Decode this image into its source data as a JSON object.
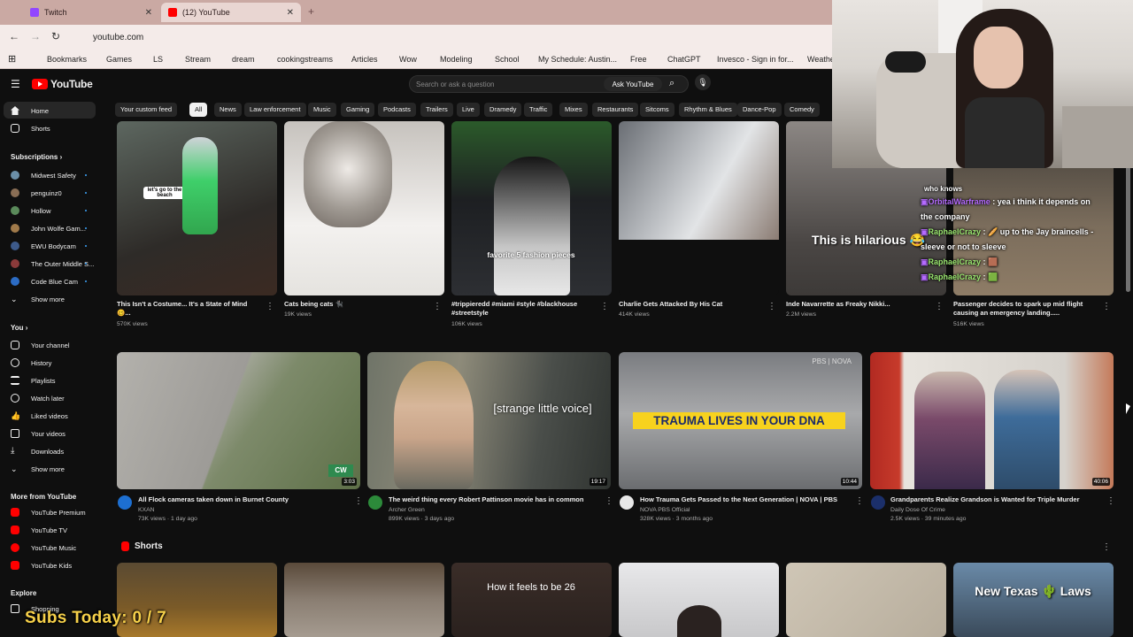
{
  "browser": {
    "tabs": [
      {
        "label": "Twitch"
      },
      {
        "label": "(12) YouTube"
      }
    ],
    "url": "youtube.com",
    "bookmarks": [
      "Bookmarks",
      "Games",
      "LS",
      "Stream",
      "dream",
      "cookingstreams",
      "Articles",
      "Wow",
      "Modeling",
      "School",
      "My Schedule: Austin...",
      "Free",
      "ChatGPT",
      "Invesco - Sign in for...",
      "Weathe"
    ]
  },
  "youtube": {
    "logo": "YouTube",
    "search_placeholder": "Search or ask a question",
    "ask_label": "Ask YouTube",
    "chips": [
      "Your custom feed",
      "All",
      "News",
      "Law enforcement",
      "Music",
      "Gaming",
      "Podcasts",
      "Trailers",
      "Live",
      "Dramedy",
      "Traffic",
      "Mixes",
      "Restaurants",
      "Sitcoms",
      "Rhythm & Blues",
      "Dance-Pop",
      "Comedy"
    ],
    "sidebar": {
      "main": [
        {
          "label": "Home"
        },
        {
          "label": "Shorts"
        }
      ],
      "subs_head": "Subscriptions",
      "subs": [
        {
          "label": "Midwest Safety"
        },
        {
          "label": "penguinz0"
        },
        {
          "label": "Hollow"
        },
        {
          "label": "John Wolfe Gam..."
        },
        {
          "label": "EWU Bodycam"
        },
        {
          "label": "The Outer Middle S..."
        },
        {
          "label": "Code Blue Cam"
        },
        {
          "label": "Show more"
        }
      ],
      "you_head": "You",
      "you": [
        {
          "label": "Your channel"
        },
        {
          "label": "History"
        },
        {
          "label": "Playlists"
        },
        {
          "label": "Watch later"
        },
        {
          "label": "Liked videos"
        },
        {
          "label": "Your videos"
        },
        {
          "label": "Downloads"
        },
        {
          "label": "Show more"
        }
      ],
      "more_head": "More from YouTube",
      "more": [
        {
          "label": "YouTube Premium"
        },
        {
          "label": "YouTube TV"
        },
        {
          "label": "YouTube Music"
        },
        {
          "label": "YouTube Kids"
        }
      ],
      "explore_head": "Explore",
      "explore": [
        {
          "label": "Shopping"
        }
      ]
    },
    "row1": [
      {
        "title": "This Isn't a Costume... It's a State of Mind",
        "title2": "🥴...",
        "meta": "570K views",
        "caption": "let's go to the beach"
      },
      {
        "title": "Cats being cats 🐈‍⬛",
        "title2": "",
        "meta": "19K views",
        "caption": ""
      },
      {
        "title": "#trippieredd #miami #style #blackhouse",
        "title2": "#streetstyle",
        "meta": "106K views",
        "caption": "favorite 5 fashion pieces"
      },
      {
        "title": "Charlie Gets Attacked By His Cat",
        "title2": "",
        "meta": "414K views",
        "caption": ""
      },
      {
        "title": "Inde Navarrette as Freaky Nikki...",
        "title2": "",
        "meta": "2.2M views",
        "caption": "This is hilarious 😂"
      },
      {
        "title": "Passenger decides to spark up mid flight",
        "title2": "causing an emergency landing.....",
        "meta": "516K views",
        "caption": ""
      }
    ],
    "row2": [
      {
        "title": "All Flock cameras taken down in Burnet County",
        "channel": "KXAN",
        "meta": "73K views · 1 day ago",
        "duration": "3:03",
        "overlay": ""
      },
      {
        "title": "The weird thing every Robert Pattinson movie has in common",
        "channel": "Archer Green",
        "meta": "899K views · 3 days ago",
        "duration": "19:17",
        "overlay": "[strange little voice]"
      },
      {
        "title": "How Trauma Gets Passed to the Next Generation | NOVA | PBS",
        "channel": "NOVA PBS Official",
        "meta": "328K views · 3 months ago",
        "duration": "10:44",
        "overlay": "TRAUMA LIVES IN YOUR DNA"
      },
      {
        "title": "Grandparents Realize Grandson is Wanted for Triple Murder",
        "channel": "Daily Dose Of Crime",
        "meta": "2.5K views · 39 minutes ago",
        "duration": "40:06",
        "overlay": ""
      }
    ],
    "shorts_label": "Shorts",
    "shorts_captions": [
      "",
      "",
      "How it feels to be 26",
      "",
      "",
      "New Texas 🌵 Laws"
    ]
  },
  "stream_overlay": {
    "chat": [
      {
        "user": "",
        "text": "who knows"
      },
      {
        "user": "OrbitalWarframe",
        "text": " : yea i think it depends on"
      },
      {
        "user": "",
        "text": "the company"
      },
      {
        "user": "RaphaelCrazy",
        "text": " : 🥖 up to the Jay braincells -"
      },
      {
        "user": "",
        "text": "sleeve or not to sleeve"
      },
      {
        "user": "RaphaelCrazy",
        "text": " : 🟫"
      },
      {
        "user": "RaphaelCrazy",
        "text": " : 🟩"
      }
    ],
    "subs_goal": "Subs Today: 0 / 7"
  },
  "colors": {
    "bg": "#0f0f0f",
    "brand": "#ff0000",
    "chip": "#272727",
    "tabbar": "#caa9a3"
  }
}
